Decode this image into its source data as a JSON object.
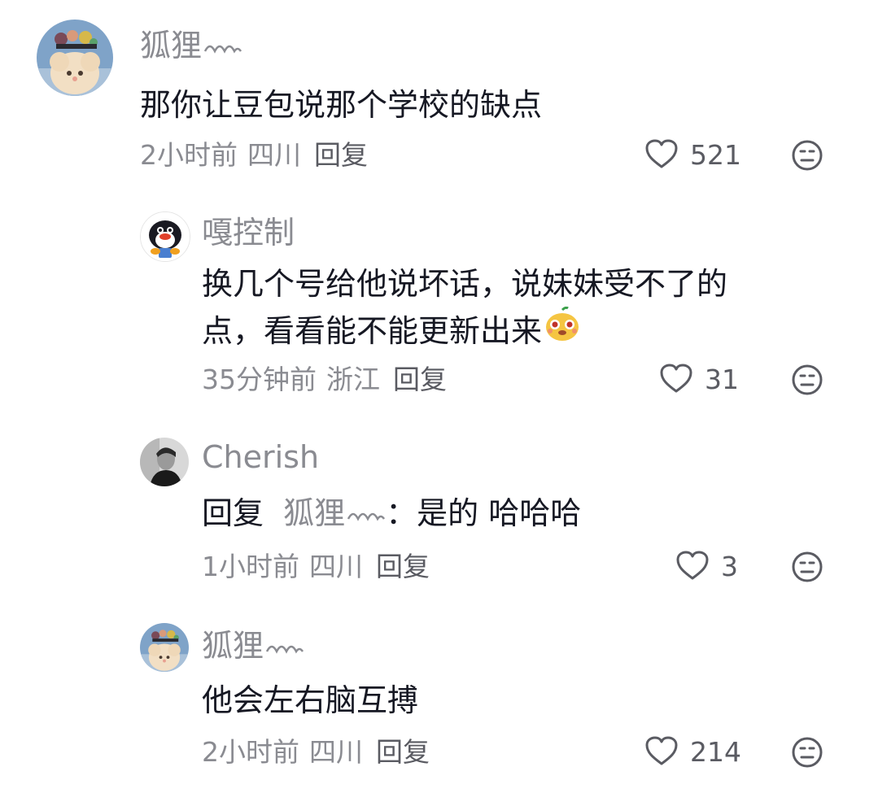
{
  "comments": [
    {
      "username": "狐狸",
      "text": "那你让豆包说那个学校的缺点",
      "time": "2小时前",
      "location": "四川",
      "reply_label": "回复",
      "likes": "521",
      "avatar": "plush-sheep-avatar"
    },
    {
      "username": "嘎控制",
      "text_line1": "换几个号给他说坏话，说妹妹受不了的",
      "text_line2": "点，看看能不能更新出来",
      "time": "35分钟前",
      "location": "浙江",
      "reply_label": "回复",
      "likes": "31",
      "avatar": "penguin-avatar",
      "emoji": "cute-face-emoji"
    },
    {
      "username": "Cherish",
      "reply_prefix": "回复",
      "mention": "狐狸",
      "text_after": "：是的 哈哈哈",
      "time": "1小时前",
      "location": "四川",
      "reply_label": "回复",
      "likes": "3",
      "avatar": "portrait-avatar"
    },
    {
      "username": "狐狸",
      "text": "他会左右脑互搏",
      "time": "2小时前",
      "location": "四川",
      "reply_label": "回复",
      "likes": "214",
      "avatar": "plush-sheep-avatar"
    }
  ],
  "colors": {
    "primary_text": "#161823",
    "secondary_text": "#8a8b91",
    "icon": "#5a5b62"
  }
}
